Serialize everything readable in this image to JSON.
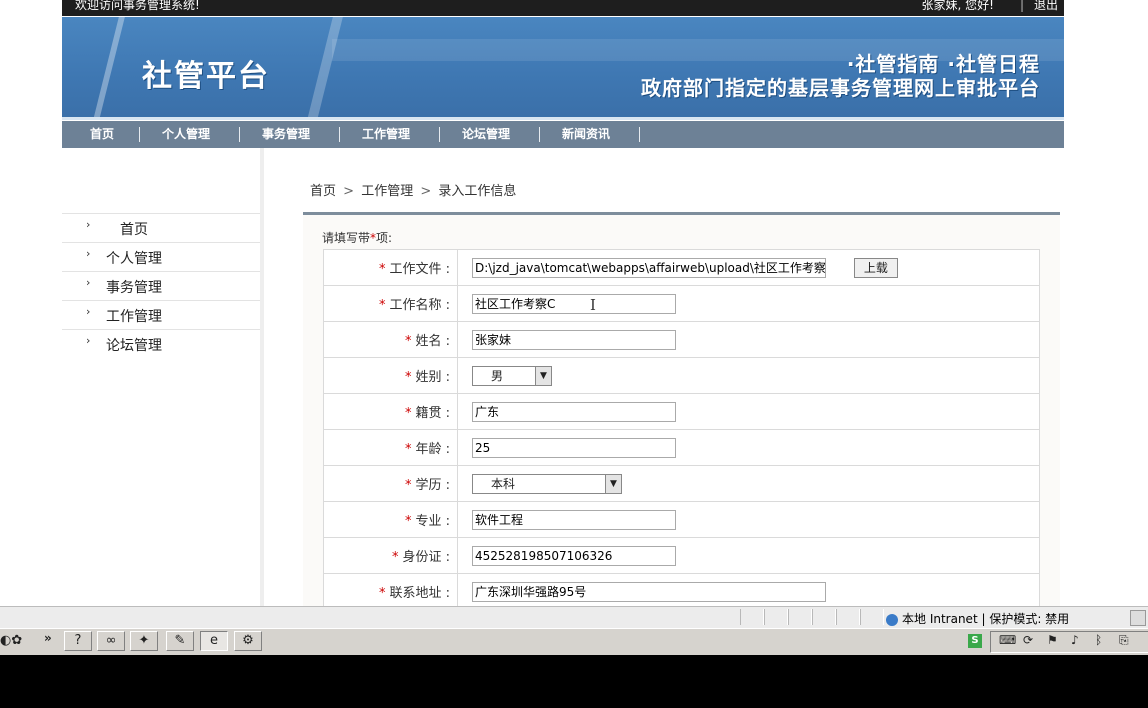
{
  "topbar": {
    "welcome": "欢迎访问事务管理系统!",
    "user_greeting": "张家妹,   您好!",
    "separator": "|",
    "logout": "退出"
  },
  "banner": {
    "logo": "社管平台",
    "slogan_line1": "·社管指南 ·社管日程",
    "slogan_line2": "政府部门指定的基层事务管理网上审批平台"
  },
  "nav": {
    "items": [
      "首页",
      "个人管理",
      "事务管理",
      "工作管理",
      "论坛管理",
      "新闻资讯"
    ],
    "separator": "|"
  },
  "sidebar": {
    "arrow": "›",
    "items": [
      "首页",
      "个人管理",
      "事务管理",
      "工作管理",
      "论坛管理"
    ]
  },
  "breadcrumb": {
    "home": "首页",
    "section": "工作管理",
    "page": "录入工作信息",
    "separator": ">"
  },
  "form": {
    "hint_prefix": "请填写带",
    "hint_star": "*",
    "hint_suffix": "项:",
    "required_mark": "*",
    "upload_label": "上载",
    "fields": [
      {
        "label": "工作文件 :",
        "value": "D:\\jzd_java\\tomcat\\webapps\\affairweb\\upload\\社区工作考察C."
      },
      {
        "label": "工作名称 :",
        "value": "社区工作考察C"
      },
      {
        "label": "姓名 :",
        "value": "张家妹"
      },
      {
        "label": "姓别 :",
        "value": "男"
      },
      {
        "label": "籍贯 :",
        "value": "广东"
      },
      {
        "label": "年龄 :",
        "value": "25"
      },
      {
        "label": "学历 :",
        "value": "本科"
      },
      {
        "label": "专业 :",
        "value": "软件工程"
      },
      {
        "label": "身份证 :",
        "value": "452528198507106326"
      },
      {
        "label": "联系地址 :",
        "value": "广东深圳华强路95号"
      }
    ],
    "dropdown_arrow": "▼"
  },
  "statusbar": {
    "zone": "本地 Intranet | 保护模式: 禁用"
  },
  "taskbar": {
    "chevron": "»",
    "tray_s": "S"
  },
  "colors": {
    "banner_blue": "#4a86c0",
    "nav_gray": "#6d8196",
    "required_red": "#cc0000"
  }
}
